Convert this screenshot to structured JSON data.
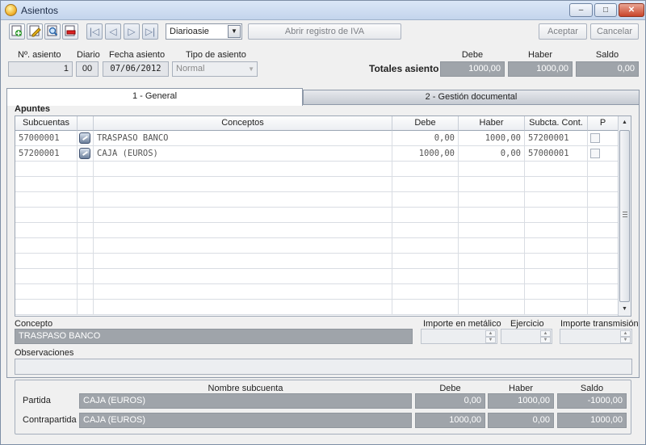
{
  "window": {
    "title": "Asientos",
    "min": "–",
    "max": "□",
    "close": "✕"
  },
  "toolbar": {
    "icons": [
      "add-icon",
      "edit-icon",
      "search-icon",
      "delete-icon"
    ],
    "nav_icons": [
      "first-icon",
      "prev-icon",
      "next-icon",
      "last-icon"
    ],
    "nav_glyphs": [
      "|◁",
      "◁",
      "▷",
      "▷|"
    ],
    "diario_combo": "Diarioasie",
    "iva_button": "Abrir registro de IVA",
    "accept_button": "Aceptar",
    "cancel_button": "Cancelar"
  },
  "header": {
    "num_label": "Nº. asiento",
    "num_value": "1",
    "diario_label": "Diario",
    "diario_value": "00",
    "fecha_label": "Fecha asiento",
    "fecha_value": "07/06/2012",
    "tipo_label": "Tipo de asiento",
    "tipo_value": "Normal",
    "totales_label": "Totales asiento",
    "debe_label": "Debe",
    "haber_label": "Haber",
    "saldo_label": "Saldo",
    "debe_value": "1000,00",
    "haber_value": "1000,00",
    "saldo_value": "0,00"
  },
  "tabs": [
    {
      "label": "1 - General",
      "active": true
    },
    {
      "label": "2 - Gestión documental",
      "active": false
    }
  ],
  "apuntes": {
    "title": "Apuntes",
    "columns": [
      "Subcuentas",
      "",
      "Conceptos",
      "Debe",
      "Haber",
      "Subcta. Cont.",
      "P"
    ],
    "rows": [
      {
        "subcuenta": "57000001",
        "concepto": "TRASPASO BANCO",
        "debe": "0,00",
        "haber": "1000,00",
        "contrapartida": "57200001"
      },
      {
        "subcuenta": "57200001",
        "concepto": "CAJA (EUROS)",
        "debe": "1000,00",
        "haber": "0,00",
        "contrapartida": "57000001"
      }
    ]
  },
  "details": {
    "concepto_label": "Concepto",
    "concepto_value": "TRASPASO BANCO",
    "importe_label": "Importe en metálico",
    "ejercicio_label": "Ejercicio",
    "transmision_label": "Importe transmisión",
    "observaciones_label": "Observaciones"
  },
  "summary": {
    "nombre_label": "Nombre subcuenta",
    "debe_label": "Debe",
    "haber_label": "Haber",
    "saldo_label": "Saldo",
    "partida": {
      "label": "Partida",
      "nombre": "CAJA (EUROS)",
      "debe": "0,00",
      "haber": "1000,00",
      "saldo": "-1000,00"
    },
    "contrapartida": {
      "label": "Contrapartida",
      "nombre": "CAJA (EUROS)",
      "debe": "1000,00",
      "haber": "0,00",
      "saldo": "1000,00"
    }
  }
}
